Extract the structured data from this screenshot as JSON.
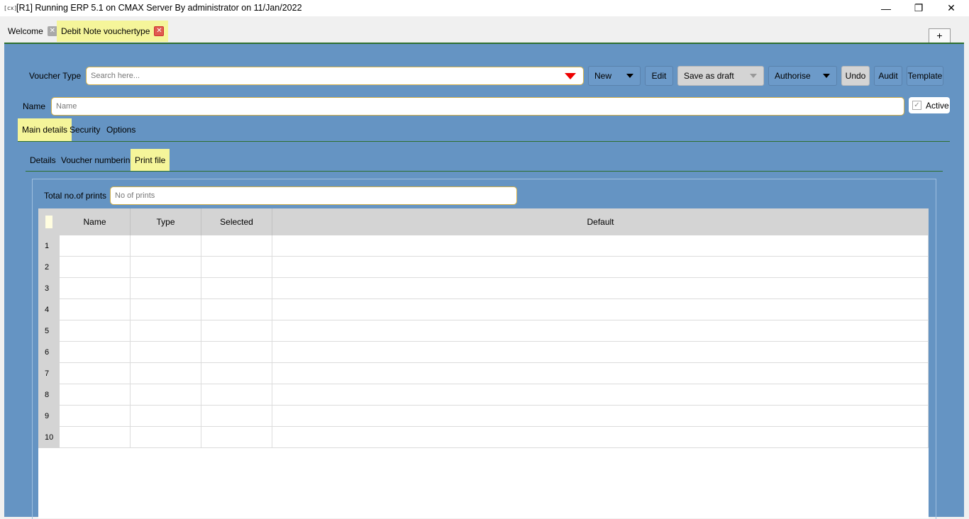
{
  "window": {
    "icon": "[cx]",
    "title": "[R1] Running ERP 5.1 on CMAX Server By administrator on 11/Jan/2022",
    "minimize": "—",
    "maximize": "❐",
    "close": "✕"
  },
  "tabs": [
    {
      "label": "Welcome"
    },
    {
      "label": "Debit Note vouchertype"
    }
  ],
  "plus_label": "+",
  "toolbar": {
    "voucher_type_label": "Voucher Type",
    "search_placeholder": "Search here...",
    "new_label": "New",
    "edit_label": "Edit",
    "save_draft_label": "Save as draft",
    "authorise_label": "Authorise",
    "undo_label": "Undo",
    "audit_label": "Audit",
    "template_label": "Template"
  },
  "name_row": {
    "label": "Name",
    "placeholder": "Name",
    "active_label": "Active",
    "active_checked": true
  },
  "main_tabs": [
    "Main details",
    "Security",
    "Options"
  ],
  "sub_tabs": [
    "Details",
    "Voucher numbering",
    "Print file"
  ],
  "prints": {
    "label": "Total no.of prints",
    "placeholder": "No of prints"
  },
  "grid": {
    "columns": [
      "Name",
      "Type",
      "Selected",
      "Default"
    ],
    "rows": [
      "1",
      "2",
      "3",
      "4",
      "5",
      "6",
      "7",
      "8",
      "9",
      "10"
    ]
  }
}
